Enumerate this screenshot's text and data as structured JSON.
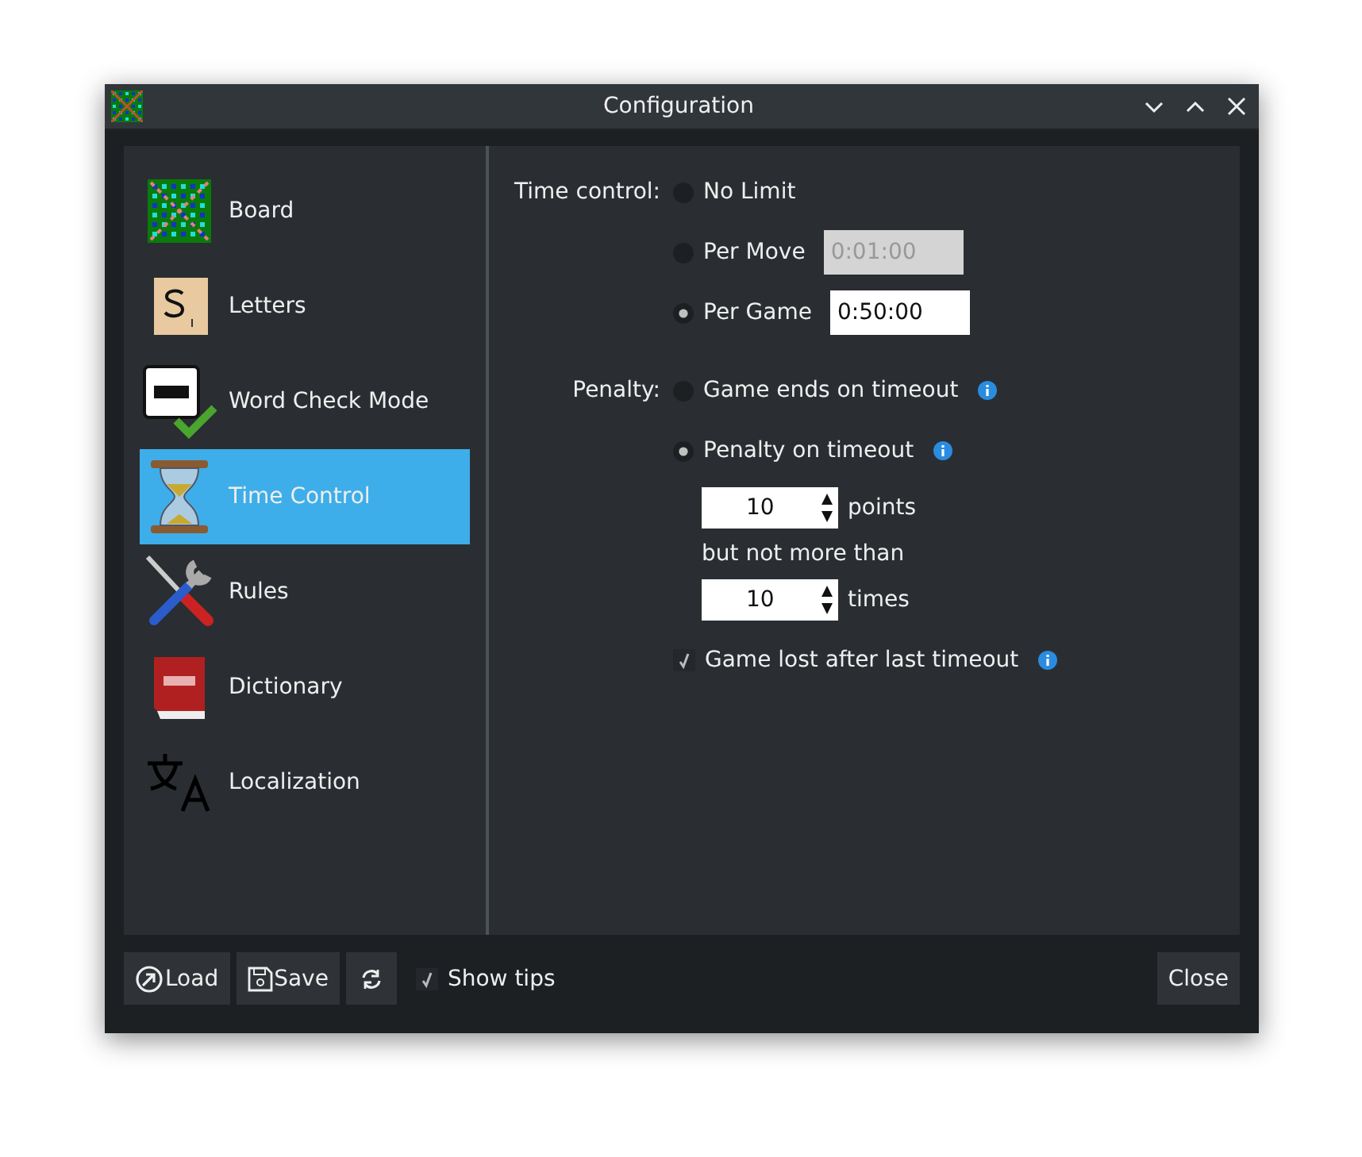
{
  "window": {
    "title": "Configuration"
  },
  "sidebar": {
    "items": [
      {
        "label": "Board",
        "selected": false
      },
      {
        "label": "Letters",
        "selected": false
      },
      {
        "label": "Word Check Mode",
        "selected": false
      },
      {
        "label": "Time Control",
        "selected": true
      },
      {
        "label": "Rules",
        "selected": false
      },
      {
        "label": "Dictionary",
        "selected": false
      },
      {
        "label": "Localization",
        "selected": false
      }
    ]
  },
  "time_control": {
    "label": "Time control:",
    "options": [
      {
        "label": "No Limit",
        "selected": false
      },
      {
        "label": "Per Move",
        "selected": false,
        "value": "0:01:00",
        "disabled": true
      },
      {
        "label": "Per Game",
        "selected": true,
        "value": "0:50:00",
        "disabled": false
      }
    ]
  },
  "penalty": {
    "label": "Penalty:",
    "options": [
      {
        "label": "Game ends on timeout",
        "selected": false
      },
      {
        "label": "Penalty on timeout",
        "selected": true
      }
    ],
    "points": {
      "value": "10",
      "unit": "points"
    },
    "limit_label": "but not more than",
    "times": {
      "value": "10",
      "unit": "times"
    },
    "game_lost": {
      "label": "Game lost after last timeout",
      "checked": true
    }
  },
  "footer": {
    "load": "Load",
    "save": "Save",
    "show_tips": {
      "label": "Show tips",
      "checked": true
    },
    "close": "Close"
  }
}
